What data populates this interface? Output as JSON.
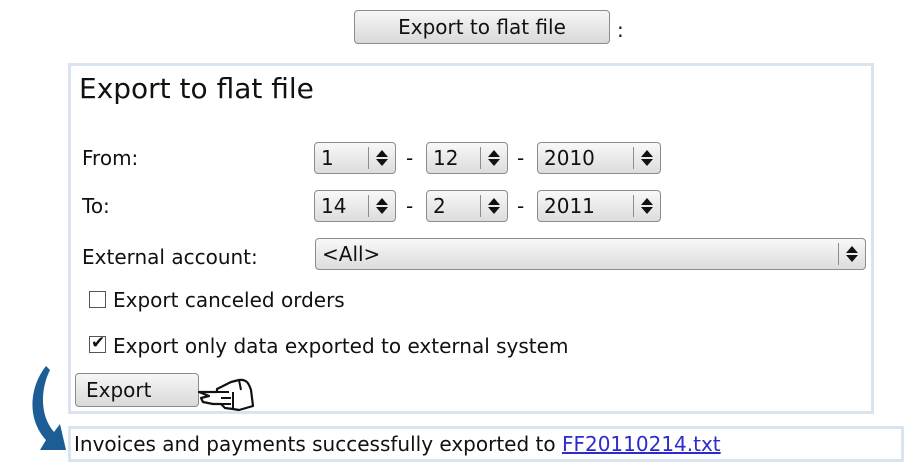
{
  "top_button": {
    "label": "Export to flat file",
    "suffix": ":"
  },
  "panel": {
    "title": "Export to flat file",
    "from": {
      "label": "From:",
      "day": "1",
      "month": "12",
      "year": "2010"
    },
    "to": {
      "label": "To:",
      "day": "14",
      "month": "2",
      "year": "2011"
    },
    "date_separator": "-",
    "external_account": {
      "label": "External account:",
      "value": "<All>"
    },
    "checkboxes": [
      {
        "label": "Export canceled orders",
        "checked": false
      },
      {
        "label": "Export only data exported to external system",
        "checked": true
      }
    ],
    "export_button": "Export"
  },
  "result": {
    "message": "Invoices and payments successfully exported to ",
    "file_link": "FF20110214.txt"
  },
  "icons": {
    "pointer": "pointing-hand-icon",
    "curved_arrow": "curved-arrow-icon",
    "select_arrows": "up-down-arrows-icon",
    "checkmark": "checkmark-icon"
  },
  "colors": {
    "panel_border": "#d9e4f0",
    "link": "#2b2bd0",
    "arrow": "#1d5d96"
  }
}
